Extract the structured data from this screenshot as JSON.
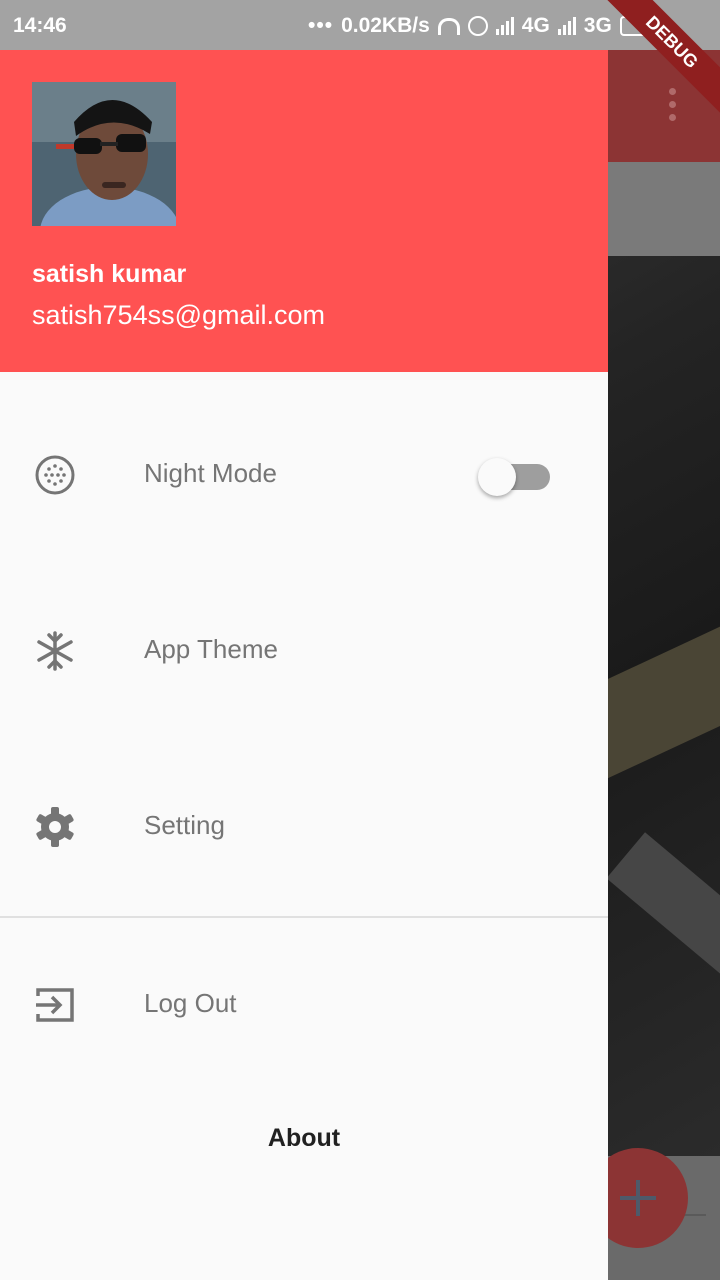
{
  "status_bar": {
    "time": "14:46",
    "network_speed": "0.02KB/s",
    "signal_1_label": "4G",
    "signal_2_label": "3G",
    "icons": [
      "more-dots-icon",
      "headphones-icon",
      "alarm-icon",
      "signal-icon",
      "signal-icon",
      "battery-charging-icon"
    ]
  },
  "debug_banner": "DEBUG",
  "drawer": {
    "header_color": "#ff5252",
    "user": {
      "name": "satish kumar",
      "email": "satish754ss@gmail.com"
    },
    "items": [
      {
        "label": "Night Mode",
        "icon": "night-mode-icon",
        "toggle": {
          "on": false
        }
      },
      {
        "label": "App Theme",
        "icon": "snowflake-icon"
      },
      {
        "label": "Setting",
        "icon": "gear-icon"
      },
      {
        "label": "Log Out",
        "icon": "exit-icon"
      }
    ],
    "footer_label": "About"
  },
  "background": {
    "app_bar_color": "#8c3434",
    "fab_icon": "plus-icon"
  }
}
